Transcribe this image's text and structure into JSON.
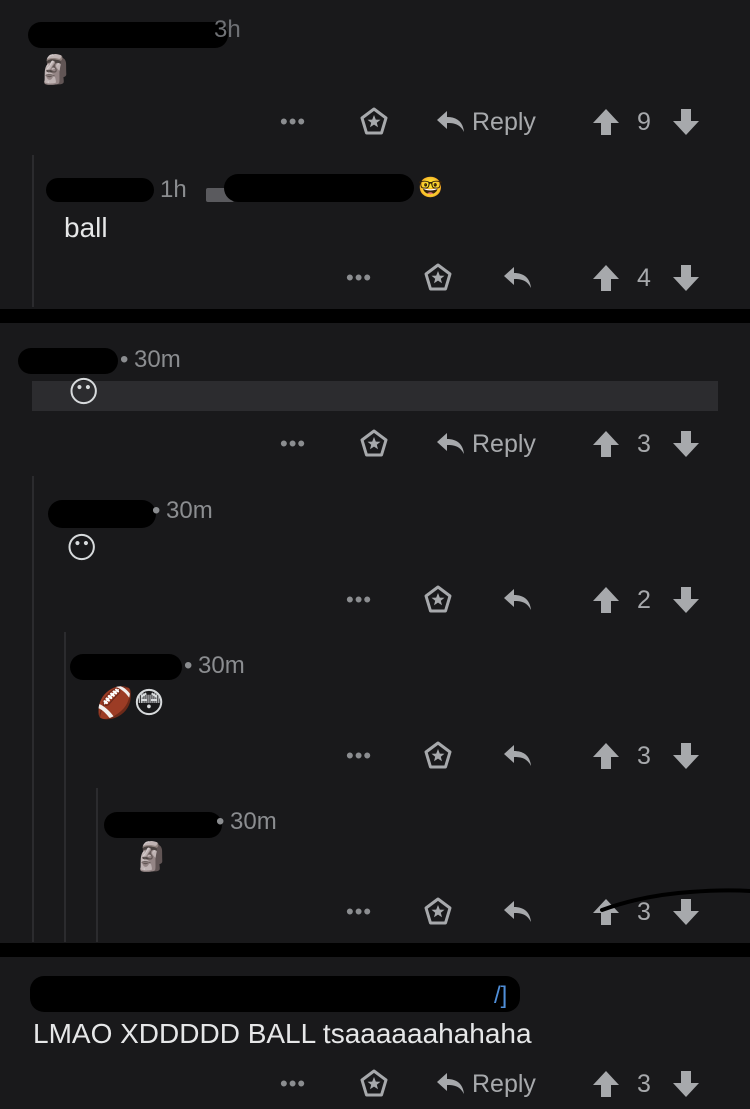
{
  "comments": [
    {
      "time": "3h",
      "body": "🗿",
      "score": "9"
    },
    {
      "time": "1h",
      "body": "ball",
      "score": "4",
      "flair_emoji": "🤓"
    },
    {
      "time": "30m",
      "body": "😶",
      "score": "3"
    },
    {
      "time": "30m",
      "body": "😶",
      "score": "2"
    },
    {
      "time": "30m",
      "body": "🏈😳",
      "score": "3"
    },
    {
      "time": "30m",
      "body": "🗿",
      "score": "3"
    },
    {
      "time": "",
      "body": "LMAO XDDDDD BALL tsaaaaaahahaha",
      "score": "3"
    }
  ],
  "actions": {
    "reply_label": "Reply",
    "more_label": "•••",
    "meta_separator": "•"
  },
  "icons": {
    "more": "more-options-icon",
    "award": "award-icon",
    "reply": "reply-arrow-icon",
    "upvote": "upvote-arrow-icon",
    "downvote": "downvote-arrow-icon"
  },
  "colors": {
    "background": "#19191b",
    "separator": "#000000",
    "text": "#d7dadc",
    "muted": "#8b8d90",
    "link": "#4f8ed8"
  }
}
